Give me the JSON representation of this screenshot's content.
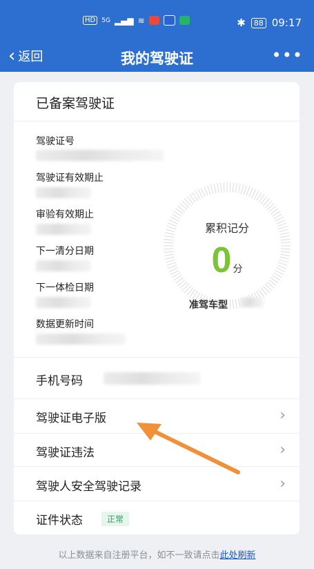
{
  "status_bar": {
    "left_icons": [
      "HD",
      "5G",
      "signal-icon",
      "wifi-icon"
    ],
    "time": "09:17",
    "battery": "88",
    "colors": {
      "red_app": "#e94a3b",
      "blue_app": "#2a63d6",
      "green_app": "#25b46a"
    }
  },
  "nav": {
    "back_label": "返回",
    "title": "我的驾驶证",
    "more": "•••"
  },
  "card": {
    "title": "已备案驾驶证",
    "info_items": [
      {
        "label": "驾驶证号"
      },
      {
        "label": "驾驶证有效期止"
      },
      {
        "label": "审验有效期止"
      },
      {
        "label": "下一清分日期"
      },
      {
        "label": "下一体检日期"
      },
      {
        "label": "数据更新时间"
      }
    ],
    "score": {
      "title": "累积记分",
      "value": "0",
      "unit": "分",
      "vehicle_label": "准驾车型"
    },
    "rows": [
      {
        "label": "手机号码"
      },
      {
        "label": "驾驶证电子版"
      },
      {
        "label": "驾驶证违法"
      },
      {
        "label": "驾驶人安全驾驶记录"
      },
      {
        "label": "证件状态",
        "badge": "正常"
      }
    ]
  },
  "footer": {
    "text": "以上数据来自注册平台，如不一致请点击",
    "link": "此处刷新"
  },
  "colors": {
    "accent": "#2c6fd1",
    "score": "#7cc436",
    "annotation_arrow": "#f0913a"
  }
}
